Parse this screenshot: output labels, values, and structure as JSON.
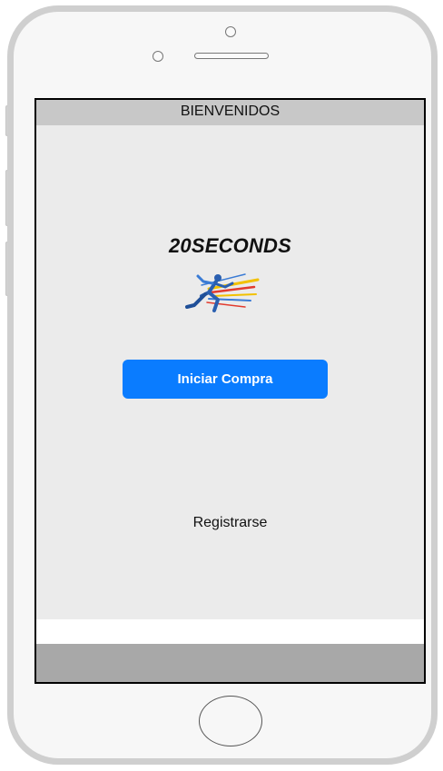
{
  "header": {
    "title": "BIENVENIDOS"
  },
  "brand": {
    "name": "20SECONDS",
    "logo_icon": "runner-logo-icon"
  },
  "actions": {
    "start_purchase_label": "Iniciar Compra",
    "register_label": "Registrarse"
  },
  "colors": {
    "primary_button": "#0a7cff",
    "header_bar": "#c8c8c8",
    "screen_background": "#ebebeb",
    "bottom_bar": "#a8a8a8"
  },
  "icons": {
    "camera": "front-camera-icon",
    "speaker": "speaker-icon",
    "home": "home-button-icon"
  }
}
